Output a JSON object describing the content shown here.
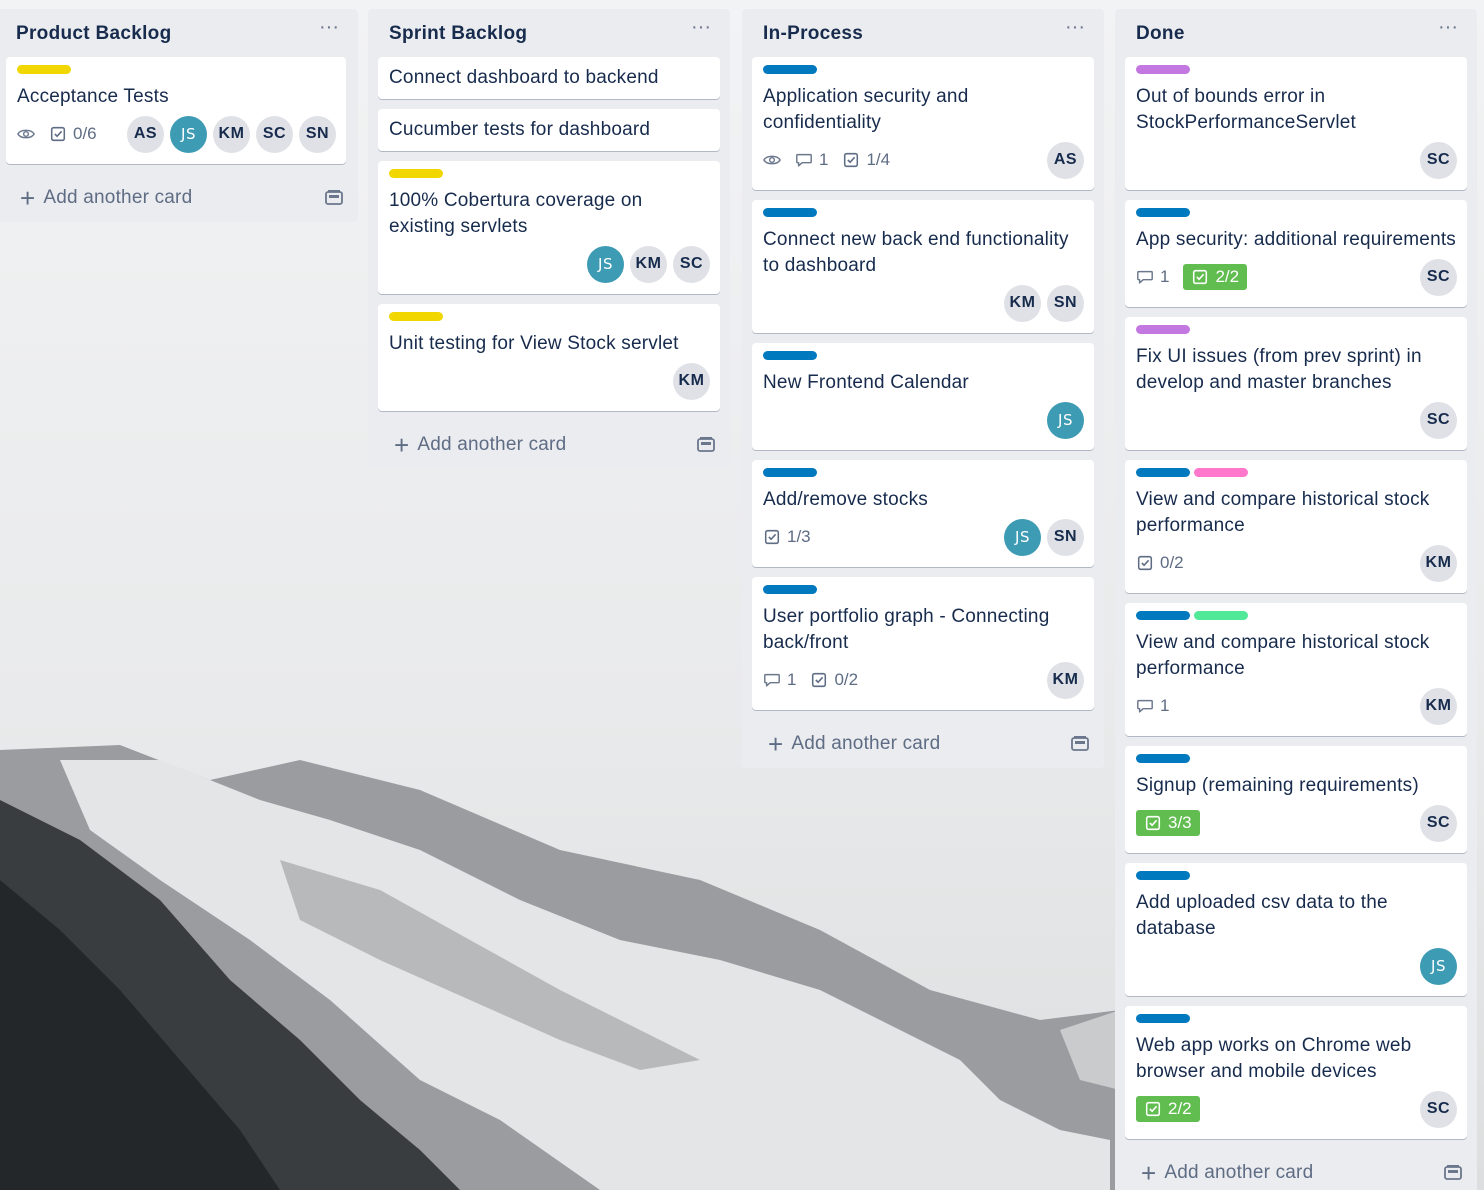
{
  "colors": {
    "yellow": "#f2d600",
    "blue": "#0079bf",
    "purple": "#c377e0",
    "pink": "#ff78cb",
    "green_label": "#51e898",
    "complete": "#61bd4f"
  },
  "add_card_label": "Add another card",
  "lists": [
    {
      "title": "Product Backlog",
      "cards": [
        {
          "labels": [
            "yellow"
          ],
          "title": "Acceptance Tests",
          "badges": [
            {
              "icon": "eye-icon",
              "text": ""
            },
            {
              "icon": "checklist-icon",
              "text": "0/6"
            }
          ],
          "members": [
            "AS",
            "JS",
            "KM",
            "SC",
            "SN"
          ]
        }
      ]
    },
    {
      "title": "Sprint Backlog",
      "cards": [
        {
          "labels": [],
          "title": "Connect dashboard to backend",
          "badges": [],
          "members": []
        },
        {
          "labels": [],
          "title": "Cucumber tests for dashboard",
          "badges": [],
          "members": []
        },
        {
          "labels": [
            "yellow"
          ],
          "title": "100% Cobertura coverage on existing servlets",
          "badges": [],
          "members": [
            "JS",
            "KM",
            "SC"
          ]
        },
        {
          "labels": [
            "yellow"
          ],
          "title": "Unit testing for View Stock servlet",
          "badges": [],
          "members": [
            "KM"
          ]
        }
      ]
    },
    {
      "title": "In-Process",
      "cards": [
        {
          "labels": [
            "blue"
          ],
          "title": "Application security and confidentiality",
          "badges": [
            {
              "icon": "eye-icon",
              "text": ""
            },
            {
              "icon": "comment-icon",
              "text": "1"
            },
            {
              "icon": "checklist-icon",
              "text": "1/4"
            }
          ],
          "members": [
            "AS"
          ]
        },
        {
          "labels": [
            "blue"
          ],
          "title": "Connect new back end functionality to dashboard",
          "badges": [],
          "members": [
            "KM",
            "SN"
          ]
        },
        {
          "labels": [
            "blue"
          ],
          "title": "New Frontend Calendar",
          "badges": [],
          "members": [
            "JS"
          ]
        },
        {
          "labels": [
            "blue"
          ],
          "title": "Add/remove stocks",
          "badges": [
            {
              "icon": "checklist-icon",
              "text": "1/3"
            }
          ],
          "members": [
            "JS",
            "SN"
          ]
        },
        {
          "labels": [
            "blue"
          ],
          "title": "User portfolio graph - Connecting back/front",
          "badges": [
            {
              "icon": "comment-icon",
              "text": "1"
            },
            {
              "icon": "checklist-icon",
              "text": "0/2"
            }
          ],
          "members": [
            "KM"
          ]
        }
      ]
    },
    {
      "title": "Done",
      "cards": [
        {
          "labels": [
            "purple"
          ],
          "title": "Out of bounds error in StockPerformanceServlet",
          "badges": [],
          "members": [
            "SC"
          ]
        },
        {
          "labels": [
            "blue"
          ],
          "title": "App security: additional requirements",
          "badges": [
            {
              "icon": "comment-icon",
              "text": "1"
            },
            {
              "icon": "checklist-icon",
              "text": "2/2",
              "complete": true
            }
          ],
          "members": [
            "SC"
          ]
        },
        {
          "labels": [
            "purple"
          ],
          "title": "Fix UI issues (from prev sprint) in develop and master branches",
          "badges": [],
          "members": [
            "SC"
          ]
        },
        {
          "labels": [
            "blue",
            "pink"
          ],
          "title": "View and compare historical stock performance",
          "badges": [
            {
              "icon": "checklist-icon",
              "text": "0/2"
            }
          ],
          "members": [
            "KM"
          ]
        },
        {
          "labels": [
            "blue",
            "green_label"
          ],
          "title": "View and compare historical stock performance",
          "badges": [
            {
              "icon": "comment-icon",
              "text": "1"
            }
          ],
          "members": [
            "KM"
          ]
        },
        {
          "labels": [
            "blue"
          ],
          "title": "Signup (remaining requirements)",
          "badges": [
            {
              "icon": "checklist-icon",
              "text": "3/3",
              "complete": true
            }
          ],
          "members": [
            "SC"
          ]
        },
        {
          "labels": [
            "blue"
          ],
          "title": "Add uploaded csv data to the database",
          "badges": [],
          "members": [
            "JS"
          ]
        },
        {
          "labels": [
            "blue"
          ],
          "title": "Web app works on Chrome web browser and mobile devices",
          "badges": [
            {
              "icon": "checklist-icon",
              "text": "2/2",
              "complete": true
            }
          ],
          "members": [
            "SC"
          ]
        }
      ]
    }
  ]
}
